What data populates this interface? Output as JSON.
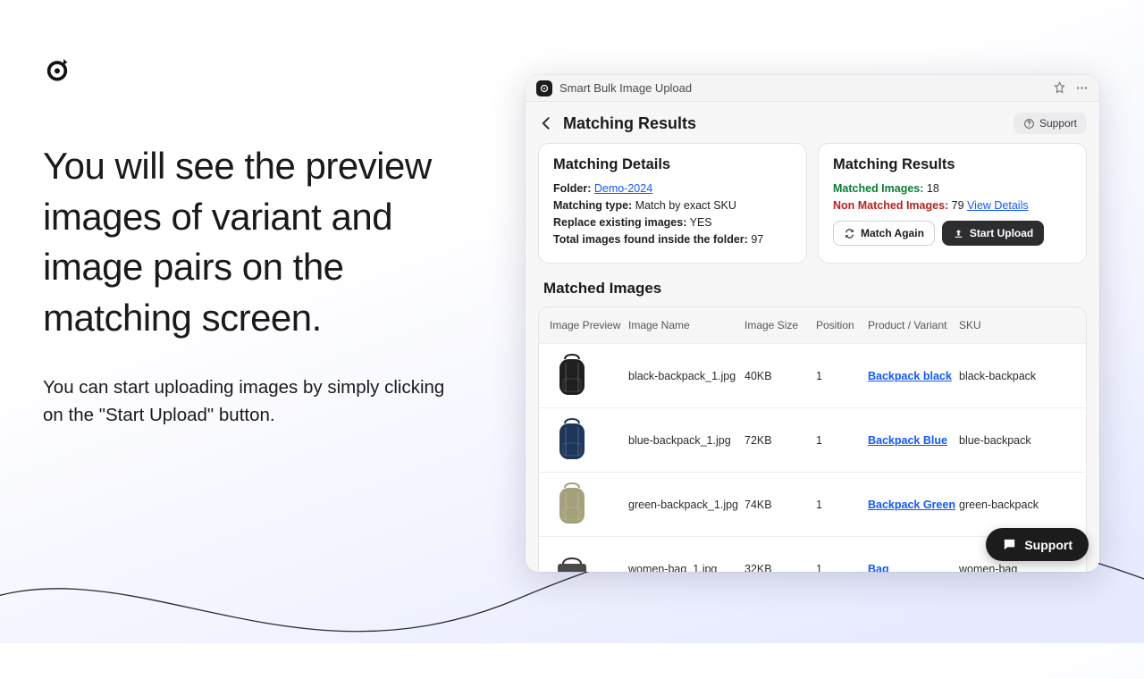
{
  "marketing": {
    "headline": "You will see the preview images of variant and image pairs on the matching screen.",
    "subhead": "You can start uploading images by simply clicking on the \"Start Upload\" button."
  },
  "titlebar": {
    "title": "Smart Bulk Image Upload"
  },
  "page": {
    "title": "Matching Results",
    "support_label": "Support"
  },
  "details": {
    "heading": "Matching Details",
    "folder_label": "Folder:",
    "folder_value": "Demo-2024",
    "matching_type_label": "Matching type:",
    "matching_type_value": "Match by exact SKU",
    "replace_label": "Replace existing images:",
    "replace_value": "YES",
    "total_label": "Total images found inside the folder:",
    "total_value": "97"
  },
  "results": {
    "heading": "Matching Results",
    "matched_label": "Matched Images:",
    "matched_value": "18",
    "nonmatched_label": "Non Matched Images:",
    "nonmatched_value": "79",
    "view_details": "View Details",
    "match_again": "Match Again",
    "start_upload": "Start Upload"
  },
  "matched_section": {
    "heading": "Matched Images"
  },
  "table": {
    "cols": {
      "preview": "Image Preview",
      "name": "Image Name",
      "size": "Image Size",
      "position": "Position",
      "variant": "Product / Variant",
      "sku": "SKU"
    },
    "rows": [
      {
        "name": "black-backpack_1.jpg",
        "size": "40KB",
        "position": "1",
        "variant": "Backpack black",
        "sku": "black-backpack",
        "color": "#1f1f1f"
      },
      {
        "name": "blue-backpack_1.jpg",
        "size": "72KB",
        "position": "1",
        "variant": "Backpack Blue",
        "sku": "blue-backpack",
        "color": "#1d3659"
      },
      {
        "name": "green-backpack_1.jpg",
        "size": "74KB",
        "position": "1",
        "variant": "Backpack Green",
        "sku": "green-backpack",
        "color": "#a3a07a"
      },
      {
        "name": "women-bag_1.jpg",
        "size": "32KB",
        "position": "1",
        "variant": "Bag",
        "sku": "women-bag",
        "color": "#474747"
      }
    ]
  },
  "chat": {
    "label": "Support"
  }
}
